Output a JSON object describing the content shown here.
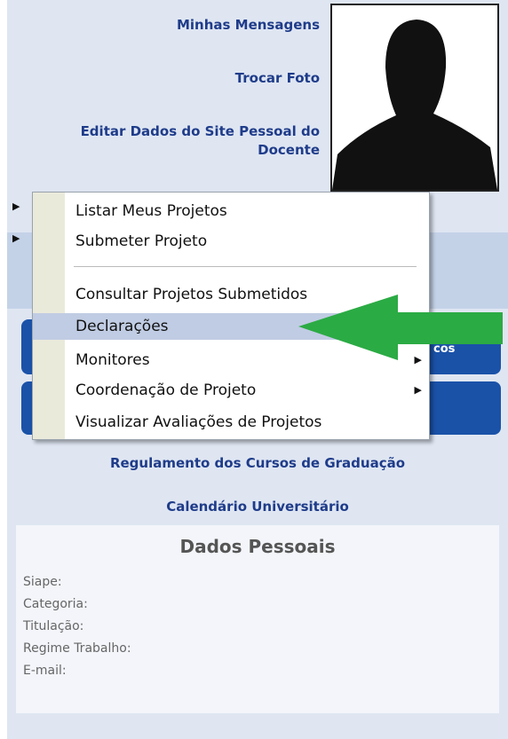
{
  "profile_links": {
    "mensagens": "Minhas Mensagens",
    "trocar_foto": "Trocar Foto",
    "editar_line1": "Editar Dados do Site Pessoal do",
    "editar_line2": "Docente"
  },
  "context_menu": {
    "items": [
      {
        "label": "Listar Meus Projetos"
      },
      {
        "label": "Submeter Projeto"
      },
      {
        "label": "Consultar Projetos Submetidos"
      },
      {
        "label": "Declarações"
      },
      {
        "label": "Monitores"
      },
      {
        "label": "Coordenação de Projeto"
      },
      {
        "label": "Visualizar Avaliações de Projetos"
      }
    ]
  },
  "partial_button_text": "cos",
  "links": {
    "regulamento": "Regulamento dos Cursos de Graduação",
    "calendario": "Calendário Universitário"
  },
  "dados_pessoais": {
    "title": "Dados Pessoais",
    "fields": [
      "Siape:",
      "Categoria:",
      "Titulação:",
      "Regime Trabalho:",
      "E-mail:"
    ]
  },
  "colors": {
    "panel_bg": "#dfe6f2",
    "link": "#1f3c8a",
    "button": "#1a52a8",
    "arrow": "#2bab44",
    "highlight": "#c0cce3"
  },
  "icons": [
    "person-silhouette-icon",
    "submenu-arrow-icon",
    "green-arrow-icon"
  ]
}
